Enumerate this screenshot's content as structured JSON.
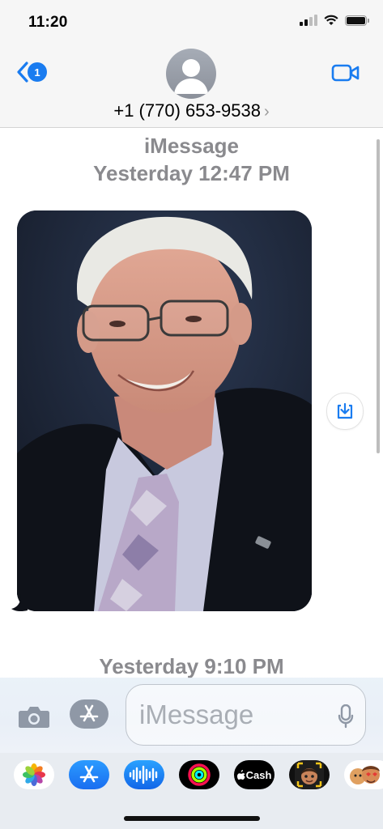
{
  "status_bar": {
    "time": "11:20"
  },
  "header": {
    "back_badge": "1",
    "contact_number": "+1 (770) 653-9538",
    "chevron": "›"
  },
  "conversation": {
    "service_label": "iMessage",
    "first_timestamp": "Yesterday 12:47 PM",
    "second_timestamp": "Yesterday 9:10 PM"
  },
  "compose": {
    "placeholder": "iMessage"
  },
  "app_drawer": {
    "items": [
      {
        "name": "photos-app",
        "label": ""
      },
      {
        "name": "app-store-app",
        "label": ""
      },
      {
        "name": "audio-message-app",
        "label": ""
      },
      {
        "name": "activity-app",
        "label": ""
      },
      {
        "name": "apple-cash-app",
        "label": "Cash"
      },
      {
        "name": "memoji-app",
        "label": ""
      },
      {
        "name": "memoji-stickers-app",
        "label": ""
      }
    ]
  },
  "colors": {
    "accent": "#1a7cf0",
    "meta_gray": "#8a8a8e",
    "header_bg": "#f6f6f6"
  }
}
